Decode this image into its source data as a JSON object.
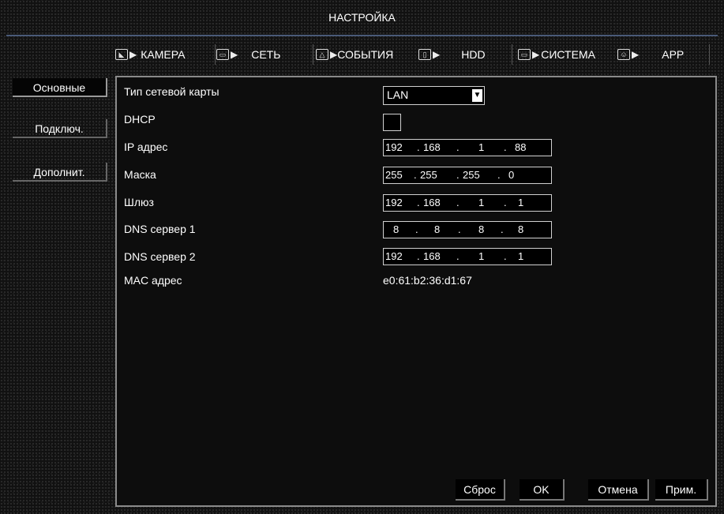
{
  "title": "НАСТРОЙКА",
  "tabs": [
    {
      "label": "КАМЕРА",
      "icon": "camera-icon"
    },
    {
      "label": "СЕТЬ",
      "icon": "network-icon"
    },
    {
      "label": "СОБЫТИЯ",
      "icon": "warning-icon"
    },
    {
      "label": "HDD",
      "icon": "hdd-icon"
    },
    {
      "label": "СИСТЕМА",
      "icon": "monitor-icon"
    },
    {
      "label": "APP",
      "icon": "app-icon"
    }
  ],
  "sidebar": {
    "items": [
      {
        "label": "Основные",
        "active": true
      },
      {
        "label": "Подключ."
      },
      {
        "label": "Дополнит."
      }
    ]
  },
  "form": {
    "nic_type_label": "Тип сетевой карты",
    "nic_type_value": "LAN",
    "dhcp_label": "DHCP",
    "dhcp_checked": false,
    "ip_label": "IP адрес",
    "ip": [
      "192",
      "168",
      "1",
      "88"
    ],
    "mask_label": "Маска",
    "mask": [
      "255",
      "255",
      "255",
      "0"
    ],
    "gateway_label": "Шлюз",
    "gateway": [
      "192",
      "168",
      "1",
      "1"
    ],
    "dns1_label": "DNS сервер 1",
    "dns1": [
      "8",
      "8",
      "8",
      "8"
    ],
    "dns2_label": "DNS сервер 2",
    "dns2": [
      "192",
      "168",
      "1",
      "1"
    ],
    "mac_label": "MAC адрес",
    "mac_value": "e0:61:b2:36:d1:67"
  },
  "buttons": {
    "reset": "Сброс",
    "ok": "OK",
    "cancel": "Отмена",
    "apply": "Прим."
  },
  "dot": "."
}
